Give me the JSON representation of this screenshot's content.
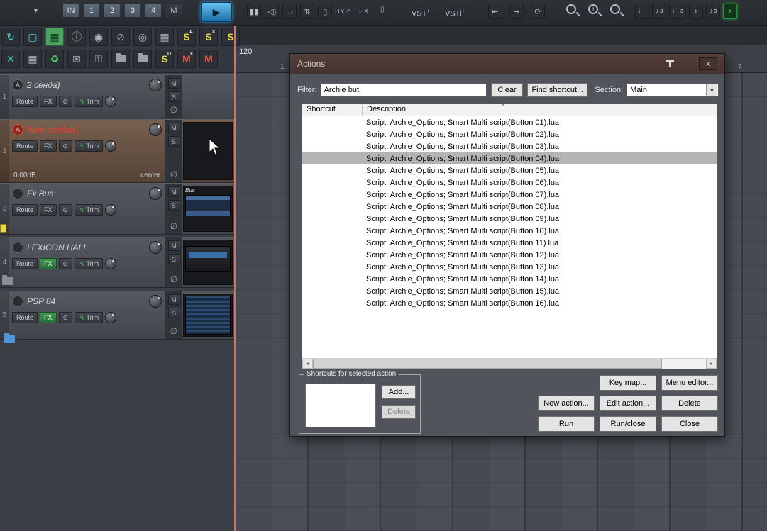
{
  "colors": {
    "accent_play": "#2f9fe0",
    "selected_track_text": "#ff3a2c",
    "fx_active_bg": "#2f7a3f",
    "edit_cursor": "#d4716f",
    "screenset_yellow": "#e8d84a",
    "mute_red": "#e05545",
    "grid_active_green": "#5fe06a",
    "dialog_title_bg": "#4a3935",
    "dialog_body_bg": "#51555b",
    "list_selection": "#b4b4b4"
  },
  "toolbar1": {
    "dropdown_glyph": "▾",
    "buttons": [
      {
        "name": "input-button",
        "label": "IN"
      },
      {
        "name": "track-button-1",
        "label": "1"
      },
      {
        "name": "track-button-2",
        "label": "2"
      },
      {
        "name": "track-button-3",
        "label": "3"
      },
      {
        "name": "track-button-4",
        "label": "4"
      },
      {
        "name": "master-button",
        "label": "M",
        "tone": "dark"
      }
    ],
    "play_glyph": "▶",
    "meter_icons": [
      {
        "name": "meter-icon",
        "glyph": "▮▮"
      },
      {
        "name": "speaker-icon",
        "glyph": "◁)"
      },
      {
        "name": "display-icon",
        "glyph": "▭"
      },
      {
        "name": "fader-icon",
        "glyph": "⇅"
      },
      {
        "name": "routing-icon",
        "glyph": "▯"
      }
    ],
    "byp_label": "BYP",
    "fx_label": "FX",
    "rack_glyph": "▯",
    "vst_label": "VST",
    "vst_sup": "+",
    "vsti_label": "VSTi",
    "vsti_sup": "+",
    "nav_icons": [
      {
        "name": "move-edit-cursor-left-icon",
        "glyph": "⇤"
      },
      {
        "name": "move-edit-cursor-right-icon",
        "glyph": "⇥"
      },
      {
        "name": "loop-toggle-icon",
        "glyph": "⟳"
      }
    ],
    "zoom_icons": [
      {
        "name": "zoom-out-icon",
        "glyph": "−"
      },
      {
        "name": "zoom-in-icon",
        "glyph": "+"
      },
      {
        "name": "zoom-selection-icon",
        "glyph": ""
      }
    ],
    "note_icons": [
      {
        "name": "grid-quarter-note-icon",
        "glyph": "♩"
      },
      {
        "name": "grid-eighth-note-icon",
        "glyph": "♪",
        "sup": "3"
      },
      {
        "name": "grid-dotted-note-icon",
        "glyph": "♩",
        "sup": "3"
      },
      {
        "name": "grid-sixteenth-note-icon",
        "glyph": "♪"
      },
      {
        "name": "grid-triplet-note-icon",
        "glyph": "♪",
        "sup": "3"
      },
      {
        "name": "grid-swing-note-icon",
        "glyph": "♪",
        "active": true
      }
    ]
  },
  "toolbar2": {
    "row1": [
      {
        "name": "scroll-sync-icon",
        "glyph": "↻",
        "tone": "teal"
      },
      {
        "name": "marquee-select-icon",
        "glyph": "▢",
        "tone": "teal"
      },
      {
        "name": "mixer-visibility-icon",
        "glyph": "▦",
        "tone": "greenbg"
      },
      {
        "name": "info-icon",
        "glyph": "ⓘ"
      },
      {
        "name": "show-all-tracks-icon",
        "glyph": "◉"
      },
      {
        "name": "hide-tracks-icon",
        "glyph": "⊘"
      },
      {
        "name": "show-in-mixer-icon",
        "glyph": "◎"
      },
      {
        "name": "track-manager-icon",
        "glyph": "▦"
      },
      {
        "name": "screenset-a-icon",
        "glyph": "S",
        "sup": "A",
        "tone": "yellow"
      },
      {
        "name": "screenset-x-icon",
        "glyph": "S",
        "sup": "×",
        "tone": "yellow"
      },
      {
        "name": "screenset-icon",
        "glyph": "S",
        "tone": "yellow"
      }
    ],
    "row2": [
      {
        "name": "close-tool-icon",
        "glyph": "✕",
        "tone": "teal"
      },
      {
        "name": "grid-settings-icon",
        "glyph": "▦"
      },
      {
        "name": "refresh-icon",
        "glyph": "♻",
        "tone": "green"
      },
      {
        "name": "notes-icon",
        "glyph": "✉"
      },
      {
        "name": "lock-icon",
        "glyph": "⚿"
      },
      {
        "name": "folder-icon",
        "glyph": "",
        "tone": "folder"
      },
      {
        "name": "folder-open-icon",
        "glyph": "",
        "tone": "folder"
      },
      {
        "name": "screenset-d-icon",
        "glyph": "S",
        "sup": "D",
        "tone": "yellow"
      },
      {
        "name": "mute-x-icon",
        "glyph": "M",
        "sup": "×",
        "tone": "red"
      },
      {
        "name": "mute-icon",
        "glyph": "M",
        "tone": "red"
      }
    ]
  },
  "ruler": {
    "tempo": "120",
    "left_label": "1.",
    "right_label": "7"
  },
  "tcp": {
    "route": "Route",
    "fx": "FX",
    "power": "⊙",
    "trim": "Trim",
    "trim_wave": "∿",
    "mute": "M",
    "solo": "S",
    "phase": "∅"
  },
  "tracks": [
    {
      "num": "1",
      "name": "2 сенда)",
      "arm": "A"
    },
    {
      "num": "2",
      "name": "Нет сендов )",
      "arm": "A",
      "db": "0.00dB",
      "pan": "center",
      "selected": true
    },
    {
      "num": "3",
      "name": "Fx Bus",
      "arm": "",
      "thumb_label": "Bus"
    },
    {
      "num": "4",
      "name": "LEXICON HALL",
      "arm": "",
      "fx_on": true
    },
    {
      "num": "5",
      "name": "PSP 84",
      "arm": "",
      "fx_on": true
    }
  ],
  "dialog": {
    "title": "Actions",
    "close_glyph": "x",
    "filter_label": "Filter:",
    "filter_value": "Archie but",
    "clear_button": "Clear",
    "find_shortcut_button": "Find shortcut...",
    "section_label": "Section:",
    "section_value": "Main",
    "select_arrow": "▼",
    "col_shortcut": "Shortcut",
    "col_description": "Description",
    "sort_indicator": "^",
    "rows": [
      {
        "text": "Script: Archie_Options;  Smart Multi script(Button 01).lua"
      },
      {
        "text": "Script: Archie_Options;  Smart Multi script(Button 02).lua"
      },
      {
        "text": "Script: Archie_Options;  Smart Multi script(Button 03).lua"
      },
      {
        "text": "Script: Archie_Options;  Smart Multi script(Button 04).lua",
        "selected": true
      },
      {
        "text": "Script: Archie_Options;  Smart Multi script(Button 05).lua"
      },
      {
        "text": "Script: Archie_Options;  Smart Multi script(Button 06).lua"
      },
      {
        "text": "Script: Archie_Options;  Smart Multi script(Button 07).lua"
      },
      {
        "text": "Script: Archie_Options;  Smart Multi script(Button 08).lua"
      },
      {
        "text": "Script: Archie_Options;  Smart Multi script(Button 09).lua"
      },
      {
        "text": "Script: Archie_Options;  Smart Multi script(Button 10).lua"
      },
      {
        "text": "Script: Archie_Options;  Smart Multi script(Button 11).lua"
      },
      {
        "text": "Script: Archie_Options;  Smart Multi script(Button 12).lua"
      },
      {
        "text": "Script: Archie_Options;  Smart Multi script(Button 13).lua"
      },
      {
        "text": "Script: Archie_Options;  Smart Multi script(Button 14).lua"
      },
      {
        "text": "Script: Archie_Options;  Smart Multi script(Button 15).lua"
      },
      {
        "text": "Script: Archie_Options;  Smart Multi script(Button 16).lua"
      }
    ],
    "scroll_left_glyph": "◄",
    "scroll_right_glyph": "►",
    "group_label": "Shortcuts for selected action",
    "add_button": "Add...",
    "delete_button": "Delete",
    "keymap_button": "Key map...",
    "menu_editor_button": "Menu editor...",
    "new_action_button": "New action...",
    "edit_action_button": "Edit action...",
    "delete_action_button": "Delete",
    "run_button": "Run",
    "run_close_button": "Run/close",
    "close_button": "Close"
  }
}
